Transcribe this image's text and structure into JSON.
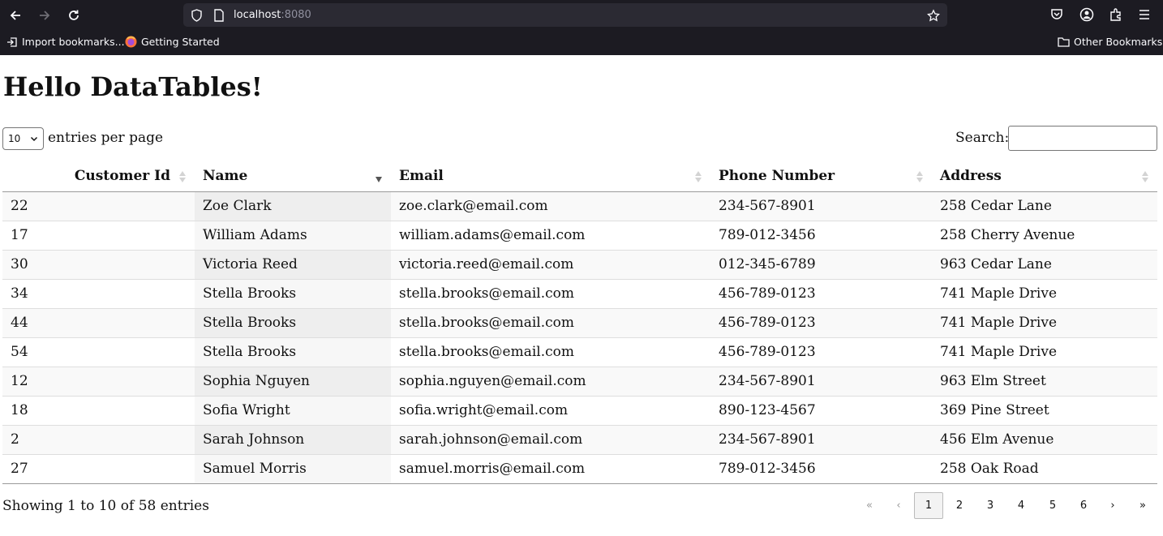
{
  "browser": {
    "url_host": "localhost",
    "url_port": ":8080",
    "bookmarks": [
      {
        "label": "Import bookmarks..."
      },
      {
        "label": "Getting Started"
      }
    ],
    "other_bookmarks": "Other Bookmarks"
  },
  "page": {
    "title": "Hello DataTables!",
    "length_value": "10",
    "length_label": "entries per page",
    "search_label": "Search:",
    "search_value": "",
    "columns": [
      "Customer Id",
      "Name",
      "Email",
      "Phone Number",
      "Address"
    ],
    "sorted_column": "Name",
    "sort_direction": "descending",
    "rows": [
      [
        "22",
        "Zoe Clark",
        "zoe.clark@email.com",
        "234-567-8901",
        "258 Cedar Lane"
      ],
      [
        "17",
        "William Adams",
        "william.adams@email.com",
        "789-012-3456",
        "258 Cherry Avenue"
      ],
      [
        "30",
        "Victoria Reed",
        "victoria.reed@email.com",
        "012-345-6789",
        "963 Cedar Lane"
      ],
      [
        "34",
        "Stella Brooks",
        "stella.brooks@email.com",
        "456-789-0123",
        "741 Maple Drive"
      ],
      [
        "44",
        "Stella Brooks",
        "stella.brooks@email.com",
        "456-789-0123",
        "741 Maple Drive"
      ],
      [
        "54",
        "Stella Brooks",
        "stella.brooks@email.com",
        "456-789-0123",
        "741 Maple Drive"
      ],
      [
        "12",
        "Sophia Nguyen",
        "sophia.nguyen@email.com",
        "234-567-8901",
        "963 Elm Street"
      ],
      [
        "18",
        "Sofia Wright",
        "sofia.wright@email.com",
        "890-123-4567",
        "369 Pine Street"
      ],
      [
        "2",
        "Sarah Johnson",
        "sarah.johnson@email.com",
        "234-567-8901",
        "456 Elm Avenue"
      ],
      [
        "27",
        "Samuel Morris",
        "samuel.morris@email.com",
        "789-012-3456",
        "258 Oak Road"
      ]
    ],
    "info": "Showing 1 to 10 of 58 entries",
    "pagination": {
      "first": "«",
      "previous": "‹",
      "pages": [
        "1",
        "2",
        "3",
        "4",
        "5",
        "6"
      ],
      "current": "1",
      "next": "›",
      "last": "»"
    }
  }
}
